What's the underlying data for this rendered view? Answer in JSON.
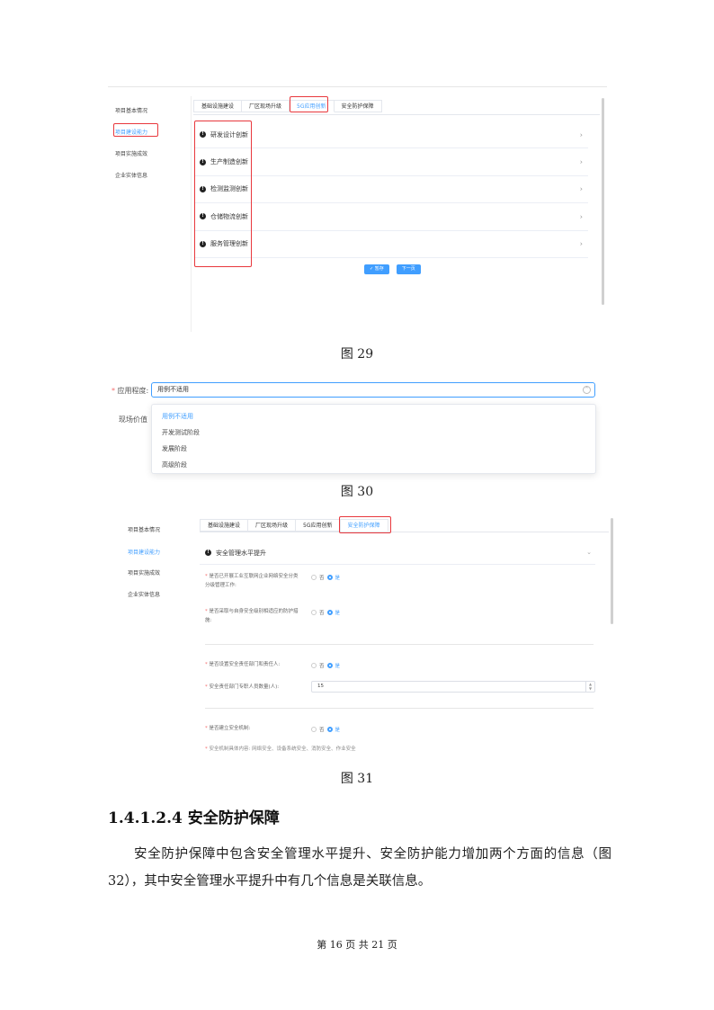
{
  "fig29": {
    "sidebar": [
      "项目基本情况",
      "项目建设能力",
      "项目实施成效",
      "企业实体信息"
    ],
    "active_sidebar_index": 1,
    "tabs": [
      "基础设施建设",
      "厂区现场升级",
      "5G应用创新",
      "安全防护保障"
    ],
    "active_tab_index": 2,
    "rows": [
      "研发设计创新",
      "生产制造创新",
      "检测监测创新",
      "仓储物流创新",
      "服务管理创新"
    ],
    "btn_save": "✓ 暂存",
    "btn_next": "下一页",
    "caption": "图 29"
  },
  "fig30": {
    "label_apply": "应用程度:",
    "required_mark": "*",
    "select_value": "用例不适用",
    "label_value": "现场价值",
    "options": [
      "用例不适用",
      "开发测试阶段",
      "发展阶段",
      "高级阶段"
    ],
    "active_option_index": 0,
    "caption": "图 30"
  },
  "fig31": {
    "sidebar": [
      "项目基本情况",
      "项目建设能力",
      "项目实施成效",
      "企业实体信息"
    ],
    "active_sidebar_index": 1,
    "tabs": [
      "基础设施建设",
      "厂区现场升级",
      "5G应用创新",
      "安全防护保障"
    ],
    "active_tab_index": 3,
    "section_title": "安全管理水平提升",
    "q1_line1": "是否已开展工业互联网企业网络安全分类",
    "q1_line2": "分级管理工作:",
    "q2_line1": "是否采取与自身安全级别相适应的防护措",
    "q2_line2": "施:",
    "q3": "是否设置安全责任部门和责任人:",
    "q4": "安全责任部门专职人员数量(人):",
    "q4_value": "15",
    "q5": "是否建立安全机制:",
    "q6_cut": "安全机制具体内容:    网络安全、设备系统安全、消防安全、作业安全",
    "no": "否",
    "yes": "是",
    "caption": "图 31"
  },
  "section": {
    "heading": "1.4.1.2.4 安全防护保障",
    "paragraph": "安全防护保障中包含安全管理水平提升、安全防护能力增加两个方面的信息（图32），其中安全管理水平提升中有几个信息是关联信息。"
  },
  "footer": "第 16 页 共 21 页"
}
